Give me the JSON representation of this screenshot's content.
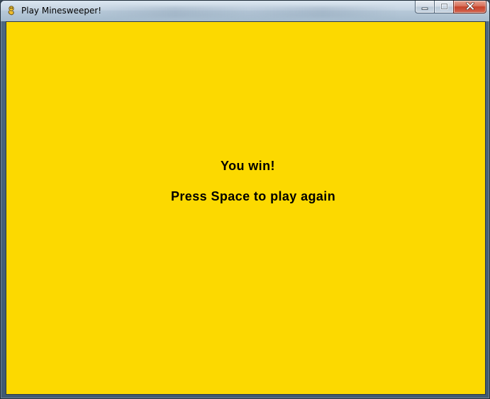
{
  "window": {
    "title": "Play Minesweeper!",
    "icon": "python-snake-icon",
    "controls": {
      "minimize_icon": "minimize-icon",
      "maximize_icon": "maximize-icon",
      "close_icon": "close-icon"
    }
  },
  "game": {
    "background_color": "#fcd900",
    "message": "You win!",
    "prompt": "Press Space to play again"
  }
}
